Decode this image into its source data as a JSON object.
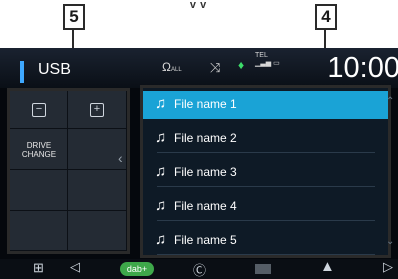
{
  "callouts": {
    "left_number": "5",
    "right_number": "4"
  },
  "header": {
    "source": "USB",
    "clock": "10:00"
  },
  "status_icons": [
    "audio-all-icon",
    "shuffle-icon",
    "bluetooth-icon",
    "tel-signal-icon",
    "battery-icon"
  ],
  "status_text": {
    "tel": "TEL"
  },
  "left_panel": {
    "drive_change": "DRIVE\nCHANGE"
  },
  "files": [
    "File name 1",
    "File name 2",
    "File name 3",
    "File name 4",
    "File name 5"
  ],
  "selected_index": 0,
  "colors": {
    "accent": "#1aa3d6",
    "usb_indicator": "#3ea8ff"
  }
}
